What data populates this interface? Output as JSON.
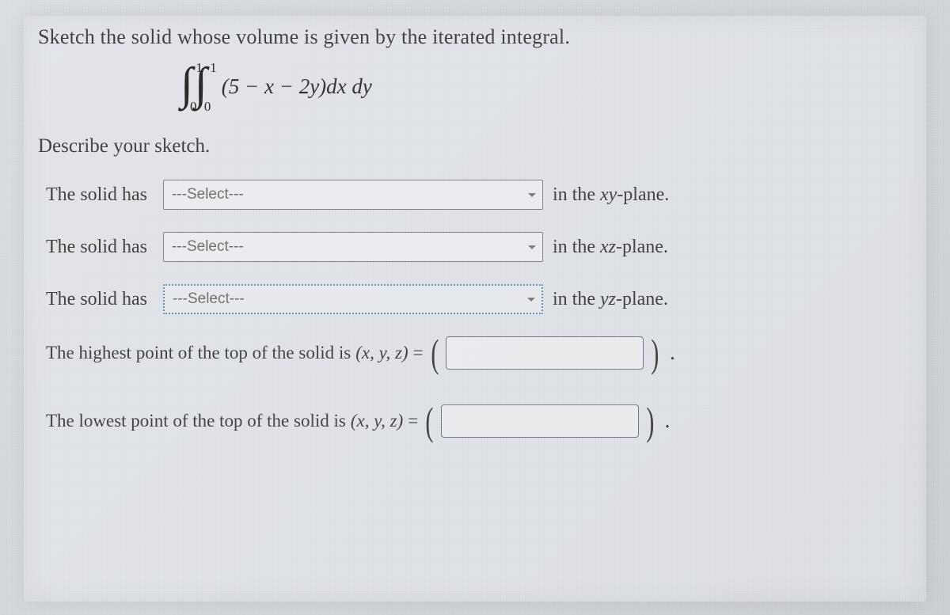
{
  "prompt": "Sketch the solid whose volume is given by the iterated integral.",
  "integral": {
    "outer_lower": "0",
    "outer_upper": "1",
    "inner_lower": "0",
    "inner_upper": "1",
    "expression": "(5 − x − 2y)dx dy"
  },
  "describe_heading": "Describe your sketch.",
  "rows": [
    {
      "prefix": "The solid has",
      "placeholder": "---Select---",
      "suffix_before": " in the ",
      "plane": "xy",
      "suffix_after": "-plane."
    },
    {
      "prefix": "The solid has",
      "placeholder": "---Select---",
      "suffix_before": " in the ",
      "plane": "xz",
      "suffix_after": "-plane."
    },
    {
      "prefix": "The solid has",
      "placeholder": "---Select---",
      "suffix_before": " in the ",
      "plane": "yz",
      "suffix_after": "-plane."
    }
  ],
  "highest_point_text": "The highest point of the top of the solid is ",
  "lowest_point_text": "The lowest point of the top of the solid is ",
  "xyz_label": "(x, y, z)",
  "equals": " = "
}
